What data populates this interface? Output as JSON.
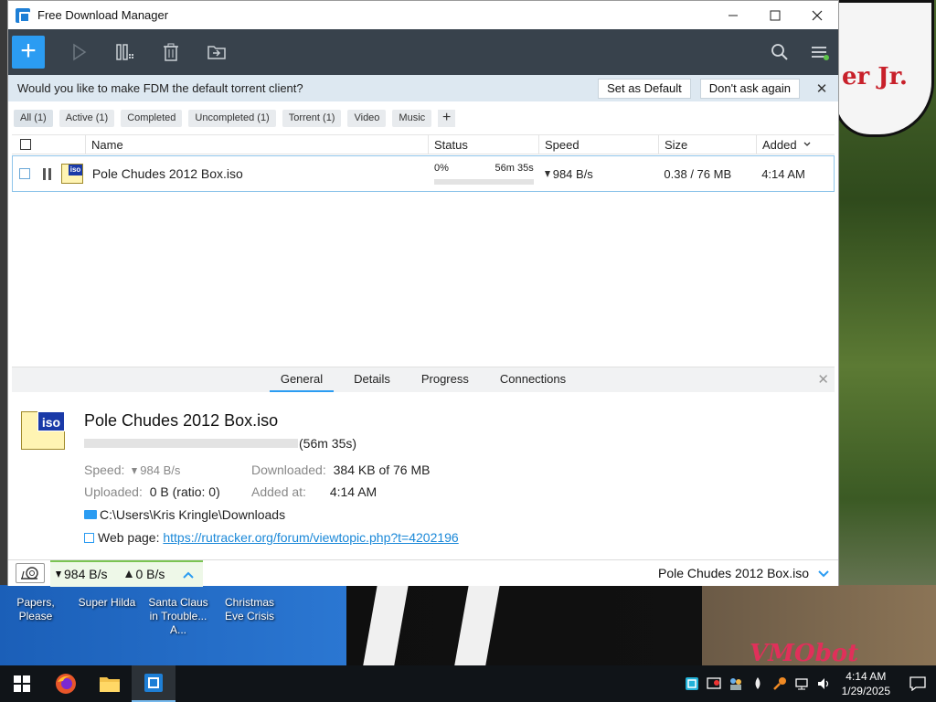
{
  "window": {
    "title": "Free Download Manager"
  },
  "banner": {
    "question": "Would you like to make FDM the default torrent client?",
    "set_default": "Set as Default",
    "dont_ask": "Don't ask again"
  },
  "filters": [
    "All (1)",
    "Active (1)",
    "Completed",
    "Uncompleted (1)",
    "Torrent (1)",
    "Video",
    "Music"
  ],
  "columns": {
    "name": "Name",
    "status": "Status",
    "speed": "Speed",
    "size": "Size",
    "added": "Added"
  },
  "download": {
    "name": "Pole Chudes 2012 Box.iso",
    "percent": "0%",
    "progress_fraction": 0.0,
    "eta": "56m 35s",
    "speed": "984 B/s",
    "size": "0.38 / 76 MB",
    "added": "4:14 AM",
    "file_badge": "iso"
  },
  "details": {
    "tabs": [
      "General",
      "Details",
      "Progress",
      "Connections"
    ],
    "title": "Pole Chudes 2012 Box.iso",
    "eta": "(56m 35s)",
    "speed_label": "Speed:",
    "speed_value": "984 B/s",
    "uploaded_label": "Uploaded:",
    "uploaded_value": "0 B (ratio: 0)",
    "downloaded_label": "Downloaded:",
    "downloaded_value": "384 KB of 76 MB",
    "added_label": "Added at:",
    "added_value": "4:14 AM",
    "folder": "C:\\Users\\Kris Kringle\\Downloads",
    "webpage_label": "Web page:",
    "webpage_url": "https://rutracker.org/forum/viewtopic.php?t=4202196"
  },
  "statusbar": {
    "down_speed": "984 B/s",
    "up_speed": "0 B/s",
    "current_file": "Pole Chudes 2012 Box.iso"
  },
  "desktop": {
    "bubble_text": "er Jr.",
    "corner_logo": "VMObot",
    "icons": [
      "Papers, Please",
      "Super Hilda",
      "Santa Claus in Trouble... A...",
      "Christmas Eve Crisis"
    ]
  },
  "taskbar": {
    "time": "4:14 AM",
    "date": "1/29/2025"
  },
  "colors": {
    "accent": "#2b9cf2",
    "toolbar": "#38424c",
    "banner": "#dde8f1",
    "speed_box": "#eef8e8"
  }
}
